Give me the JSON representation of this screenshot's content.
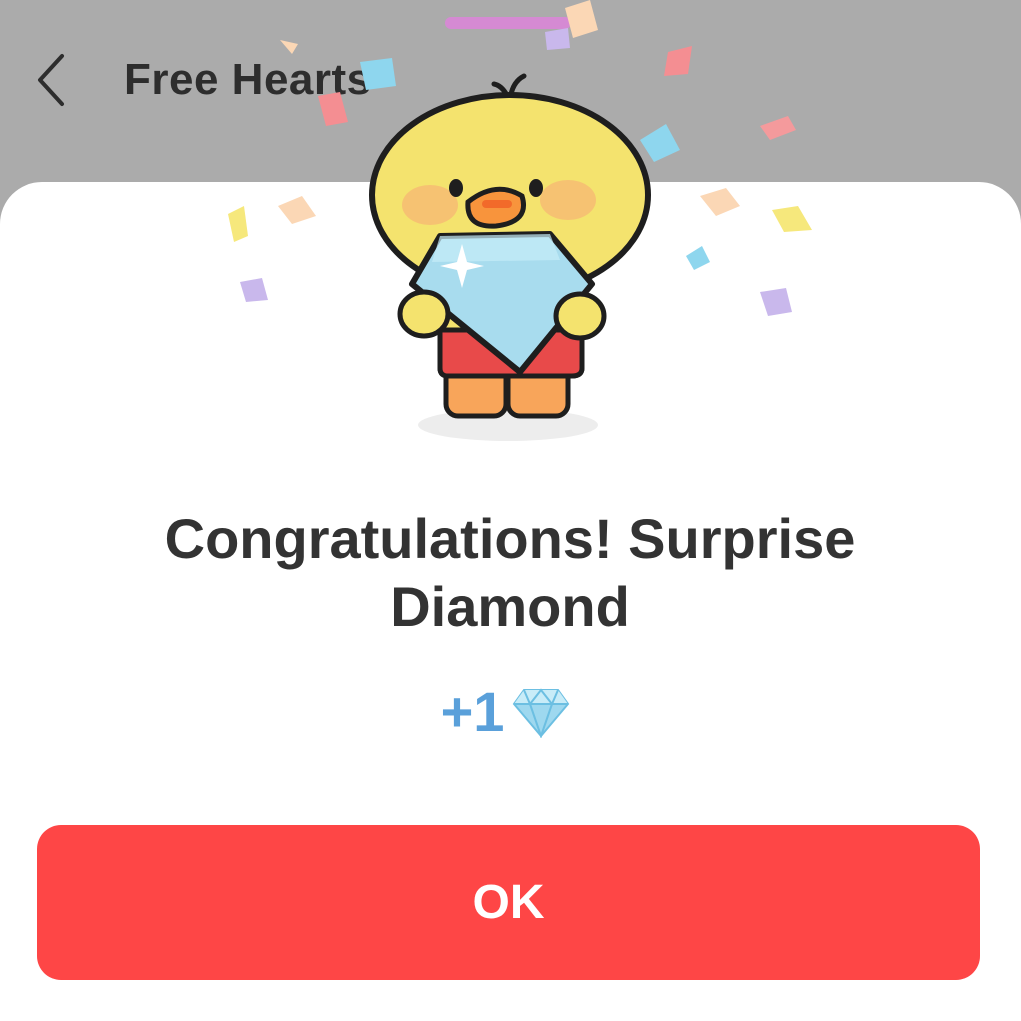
{
  "header": {
    "title": "Free Hearts",
    "back_icon": "chevron-left-icon"
  },
  "dialog": {
    "title": "Congratulations! Surprise Diamond",
    "reward": {
      "amount": "+1",
      "icon": "diamond-icon"
    },
    "ok_label": "OK",
    "illustration": "duck-holding-diamond"
  },
  "colors": {
    "overlay": "#ababab",
    "sheet": "#ffffff",
    "accent": "#fe4646",
    "reward_text": "#5aa0da",
    "title_text": "#333333"
  }
}
